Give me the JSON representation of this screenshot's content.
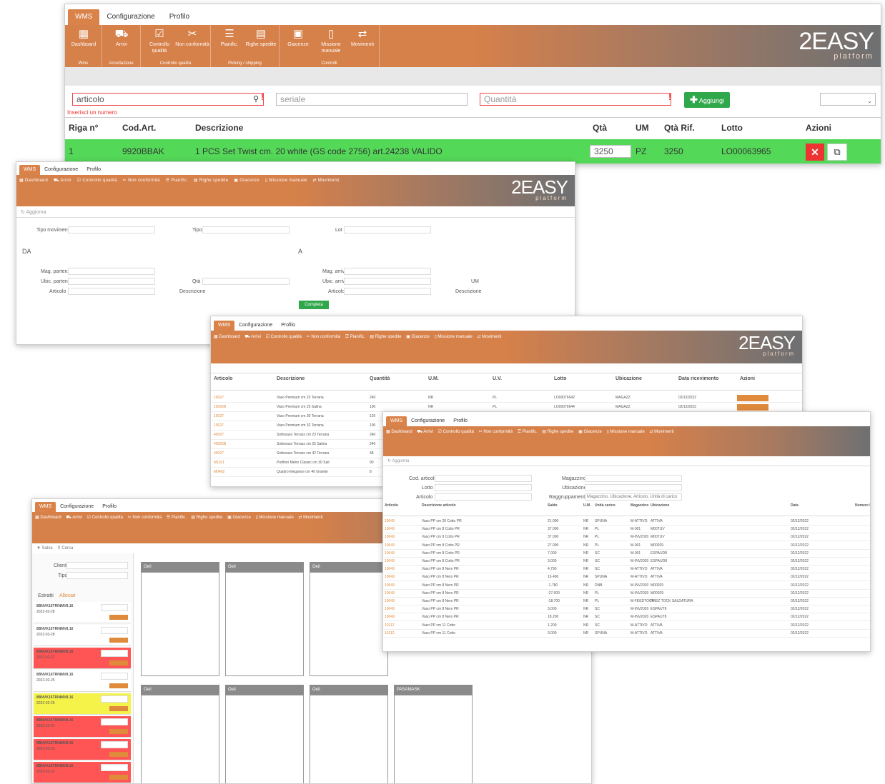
{
  "colors": {
    "accent": "#d9834a",
    "add_button": "#2ea84a",
    "row_ok": "#54d858",
    "delete": "#e33"
  },
  "tabs": [
    "WMS",
    "Configurazione",
    "Profilo"
  ],
  "toolbar_groups": [
    {
      "label": "Wms",
      "buttons": [
        {
          "label": "Dashboard",
          "icon": "chart-icon"
        }
      ]
    },
    {
      "label": "Accettazione",
      "buttons": [
        {
          "label": "Arrivi",
          "icon": "truck-icon"
        }
      ]
    },
    {
      "label": "Controllo qualità",
      "buttons": [
        {
          "label": "Controllo qualità",
          "icon": "check-icon"
        },
        {
          "label": "Non conformità",
          "icon": "tools-icon"
        }
      ]
    },
    {
      "label": "Picking / shipping",
      "buttons": [
        {
          "label": "Pianific.",
          "icon": "list-icon"
        },
        {
          "label": "Righe spedite",
          "icon": "rows-icon"
        }
      ]
    },
    {
      "label": "Controlli",
      "buttons": [
        {
          "label": "Giacenze",
          "icon": "box-icon"
        },
        {
          "label": "Missione manuale",
          "icon": "document-icon"
        },
        {
          "label": "Movimenti",
          "icon": "arrows-icon"
        }
      ]
    }
  ],
  "logo": {
    "main": "2EASY",
    "sub": "platform"
  },
  "w1": {
    "articolo": "articolo",
    "seriale": "seriale",
    "quantita": "Quantità",
    "hint": "Inserisci un numero",
    "add": "Aggiungi",
    "headers": [
      "Riga n°",
      "Cod.Art.",
      "Descrizione",
      "Qtà",
      "UM",
      "Qtà Rif.",
      "Lotto",
      "Azioni"
    ],
    "row": {
      "n": "1",
      "code": "9920BBAK",
      "desc": "1 PCS Set Twist cm. 20 white (GS code 2756) art.24238 VALIDO",
      "qta": "3250",
      "um": "PZ",
      "qrif": "3250",
      "lotto": "LO00063965"
    }
  },
  "w2": {
    "aggiorna": "Aggiorna",
    "da": "DA",
    "a": "A",
    "tipo_mov": "Tipo movimento",
    "tipo": "Tipo",
    "lotto": "Lot",
    "completa": "Completa",
    "labels_da": [
      "Mag. partenza",
      "Ubic. partenza",
      "Articolo"
    ],
    "labels_a": [
      "Mag. arrivo",
      "Ubic. arrivo",
      "Articolo"
    ],
    "qta": "Qtà",
    "descrizione": "Descrizione",
    "um": "UM"
  },
  "w3": {
    "headers": [
      "Articolo",
      "Descrizione",
      "Quantità",
      "U.M.",
      "U.V.",
      "Lotto",
      "Ubicazione",
      "Data ricevimento",
      "Azioni"
    ],
    "rows": [
      [
        "10027",
        "Vaso Premium cm 23 Terrana",
        "240",
        "NR",
        "PL",
        "LO00076642",
        "MAGAZZ",
        "02/12/2022"
      ],
      [
        "10025B",
        "Vaso Premium cm 25 Salina",
        "100",
        "NR",
        "PL",
        "LO00076644",
        "MAGAZZ",
        "02/12/2022"
      ],
      [
        "10037",
        "Vaso Premium cm 30 Terrana",
        "120",
        "NR",
        "PL",
        "",
        "",
        ""
      ],
      [
        "10027",
        "Vaso Premium cm 32 Terrana",
        "100",
        "NR",
        "PL",
        "",
        "",
        ""
      ],
      [
        "40027",
        "Sottovaso Terrass cm 23 Terrana",
        "240",
        "NR",
        "PL",
        "",
        "",
        ""
      ],
      [
        "40025B",
        "Sottovaso Terrass cm 25 Salina",
        "240",
        "NR",
        "PL",
        "",
        "",
        ""
      ],
      [
        "40027",
        "Sottovaso Terrass cm 42 Terrana",
        "48",
        "NR",
        "PL",
        "",
        "",
        ""
      ],
      [
        "M1101",
        "Portfiori Metro Classic cm 30 Sali",
        "90",
        "NR",
        "PL",
        "",
        "",
        ""
      ],
      [
        "M0402",
        "Quadro Elegance cm 40 Granite",
        "8",
        "NR",
        "PL",
        "",
        "",
        ""
      ]
    ]
  },
  "w4": {
    "aggiorna": "Aggiorna",
    "filters": [
      "Cod. articolo",
      "Lotto",
      "Articolo",
      "Magazzino",
      "Ubicazione",
      "Raggruppamento"
    ],
    "group_value": "Magazzino, Ubicazione, Articolo, Unità di carico",
    "headers": [
      "Articolo",
      "Descrizione articolo",
      "Saldo",
      "U.M.",
      "Unità carico",
      "Magazzino",
      "Ubicazione",
      "Data",
      "Numero Lotto"
    ],
    "rows": [
      [
        "10049",
        "Vaso PP cm 20 Cotto PR",
        "21.000",
        "NR",
        "SPUNA",
        "M-ATTIVO",
        "ATTIVA",
        "02/12/2022"
      ],
      [
        "10049",
        "Vaso PP cm 8 Cotto PR",
        "37.000",
        "NR",
        "PL",
        "M-001",
        "M00TUV",
        "02/12/2022"
      ],
      [
        "10049",
        "Vaso PP cm 8 Cotto PR",
        "37.000",
        "NR",
        "PL",
        "M-INV2020",
        "M00TUV",
        "02/12/2022"
      ],
      [
        "10049",
        "Vaso PP cm 8 Cotto PR",
        "27.000",
        "NR",
        "PL",
        "M-001",
        "M00029",
        "02/12/2022"
      ],
      [
        "10049",
        "Vaso PP cm 8 Cotto PR",
        "7.000",
        "NR",
        "SC",
        "M-001",
        "ESPAUD8",
        "02/12/2022"
      ],
      [
        "10049",
        "Vaso PP cm 8 Cotto PR",
        "3.000",
        "NR",
        "SC",
        "M-INV2020",
        "ESPAUD8",
        "02/12/2022"
      ],
      [
        "10049",
        "Vaso PP cm 8 Nero PR",
        "4.790",
        "NR",
        "SC",
        "M-ATTIVO",
        "ATTIVA",
        "02/12/2022"
      ],
      [
        "10049",
        "Vaso PP cm 8 Nero PR",
        "16.400",
        "NR",
        "SPUNA",
        "M-ATTIVO",
        "ATTIVA",
        "02/12/2022"
      ],
      [
        "10049",
        "Vaso PP cm 8 Nero PR",
        "-1.780",
        "NR",
        "DNB",
        "M-INV2020",
        "M00029",
        "02/12/2022"
      ],
      [
        "10049",
        "Vaso PP cm 8 Nero PR",
        "-27.000",
        "NR",
        "PL",
        "M-INV2020",
        "M00029",
        "02/12/2022"
      ],
      [
        "10049",
        "Vaso PP cm 8 Nero PR",
        "-18.700",
        "NR",
        "PL",
        "M-FEEDTOCK",
        "PREZ TOCK SALDATURA",
        "02/12/2022"
      ],
      [
        "10049",
        "Vaso PP cm 8 Nero PR",
        "3.000",
        "NR",
        "SC",
        "M-INV2020",
        "ESPAUT8",
        "02/12/2022"
      ],
      [
        "10049",
        "Vaso PP cm 8 Nero PR",
        "18.200",
        "NR",
        "SC",
        "M-INV2020",
        "ESPAUT8",
        "02/12/2022"
      ],
      [
        "10112",
        "Vaso PP cm 11 Cotto",
        "1.200",
        "NR",
        "SC",
        "M-ATTIVO",
        "ATTIVA",
        "02/12/2022"
      ],
      [
        "10112",
        "Vaso PP cm 11 Cotto",
        "3.000",
        "NR",
        "SPUNA",
        "M-ATTIVO",
        "ATTIVA",
        "02/12/2022"
      ]
    ]
  },
  "w5": {
    "salva": "Salva",
    "cerca": "Cerca",
    "filters": [
      "Cliente",
      "Tipo"
    ],
    "tabs": [
      "Estratti",
      "Allocati"
    ],
    "cards": [
      {
        "code": "8BNVK16TRINMV8.16",
        "sub": "2022-02-28",
        "c": "#fff"
      },
      {
        "code": "8BNVK16TRINMV8.16",
        "sub": "2022-02-28",
        "c": "#fff"
      },
      {
        "code": "8BNVK16TRINMV8.16",
        "sub": "2022-02-27",
        "c": "#f55"
      },
      {
        "code": "8BNVK16TRINMV8.16",
        "sub": "2022-02-25",
        "c": "#fff"
      },
      {
        "code": "8BNVK16TRINMV8.16",
        "sub": "2022-02-25",
        "c": "#f5f24a"
      },
      {
        "code": "8BNVK16TRINMV8.16",
        "sub": "2022-02-24",
        "c": "#f55"
      },
      {
        "code": "8BNVK16TRINMV8.16",
        "sub": "2022-02-23",
        "c": "#f55"
      },
      {
        "code": "8BNVK16TRINMV8.16",
        "sub": "2022-02-22",
        "c": "#f55"
      }
    ],
    "columns_top": [
      "Oeil",
      "Oeil",
      "Oeil"
    ],
    "columns_bottom": [
      "Oeil",
      "Oeil",
      "Oeil",
      "PASAMASK"
    ]
  }
}
